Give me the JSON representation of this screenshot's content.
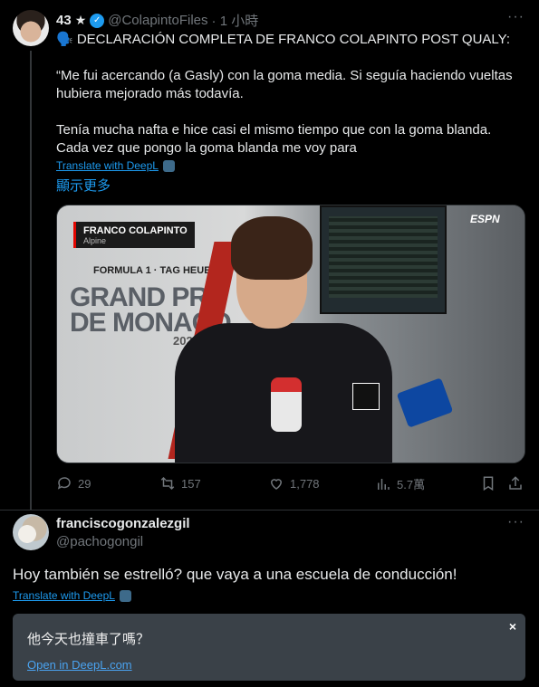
{
  "tweet1": {
    "display_name": "43",
    "handle": "@ColapintoFiles",
    "time": "· 1 小時",
    "heading": "🗣️ DECLARACIÓN COMPLETA DE FRANCO COLAPINTO POST QUALY:",
    "quote_line1": "“Me fui acercando (a Gasly) con la goma media. Si seguía haciendo vueltas hubiera mejorado más todavía.",
    "quote_line2": "Tenía mucha nafta e hice casi el mismo tiempo que con la goma blanda. Cada vez que pongo la goma blanda me voy para",
    "translate": "Translate with DeepL",
    "show_more": "顯示更多",
    "media": {
      "nameplate_name": "FRANCO COLAPINTO",
      "nameplate_team": "Alpine",
      "broadcaster": "ESPN",
      "banner_top": "FORMULA 1 · TAG HEUER",
      "banner_main": "GRAND PRI DE MONACO",
      "banner_year": "2025"
    },
    "stats": {
      "replies": "29",
      "retweets": "157",
      "likes": "1,778",
      "views": "5.7萬"
    }
  },
  "tweet2": {
    "display_name": "franciscogonzalezgil",
    "handle": "@pachogongil",
    "text": "Hoy también se estrelló?  que vaya a una escuela de conducción!",
    "translate": "Translate with DeepL"
  },
  "deepl_popup": {
    "translation": "他今天也撞車了嗎？",
    "open_link": "Open in DeepL.com",
    "close": "×"
  },
  "colors": {
    "accent": "#1d9bf0",
    "background": "#000000",
    "muted": "#71767b"
  }
}
